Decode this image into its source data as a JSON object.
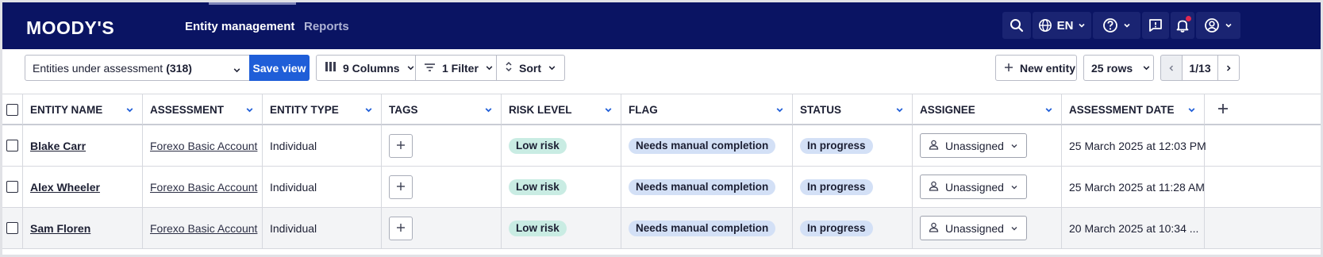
{
  "header": {
    "logo": "MOODY'S",
    "nav": [
      {
        "label": "Entity management",
        "active": true
      },
      {
        "label": "Reports",
        "active": false
      }
    ],
    "language": "EN",
    "icons": [
      "search-icon",
      "globe-icon",
      "help-icon",
      "chat-icon",
      "bell-icon",
      "user-icon"
    ],
    "colors": {
      "background": "#0a1463",
      "button": "#1a2472",
      "notification": "#e0284f"
    }
  },
  "toolbar": {
    "view_label": "Entities under assessment",
    "view_count": "(318)",
    "save_view": "Save view",
    "columns": "9 Columns",
    "filter": "1 Filter",
    "sort": "Sort",
    "new_entity": "New entity",
    "rows": "25 rows",
    "page": "1/13"
  },
  "table": {
    "columns": [
      "ENTITY NAME",
      "ASSESSMENT",
      "ENTITY TYPE",
      "TAGS",
      "RISK LEVEL",
      "FLAG",
      "STATUS",
      "ASSIGNEE",
      "ASSESSMENT DATE"
    ],
    "rows": [
      {
        "name": "Blake Carr",
        "assessment": "Forexo Basic Account",
        "type": "Individual",
        "risk": "Low risk",
        "flag": "Needs manual completion",
        "status": "In progress",
        "assignee": "Unassigned",
        "date": "25 March 2025 at 12:03 PM"
      },
      {
        "name": "Alex Wheeler",
        "assessment": "Forexo Basic Account",
        "type": "Individual",
        "risk": "Low risk",
        "flag": "Needs manual completion",
        "status": "In progress",
        "assignee": "Unassigned",
        "date": "25 March 2025 at 11:28 AM"
      },
      {
        "name": "Sam Floren",
        "assessment": "Forexo Basic Account",
        "type": "Individual",
        "risk": "Low risk",
        "flag": "Needs manual completion",
        "status": "In progress",
        "assignee": "Unassigned",
        "date": "20 March 2025 at 10:34 ..."
      }
    ],
    "colors": {
      "risk_pill": "#c9ece3",
      "flag_pill": "#d3e0f6",
      "primary": "#1f5ed8"
    }
  }
}
